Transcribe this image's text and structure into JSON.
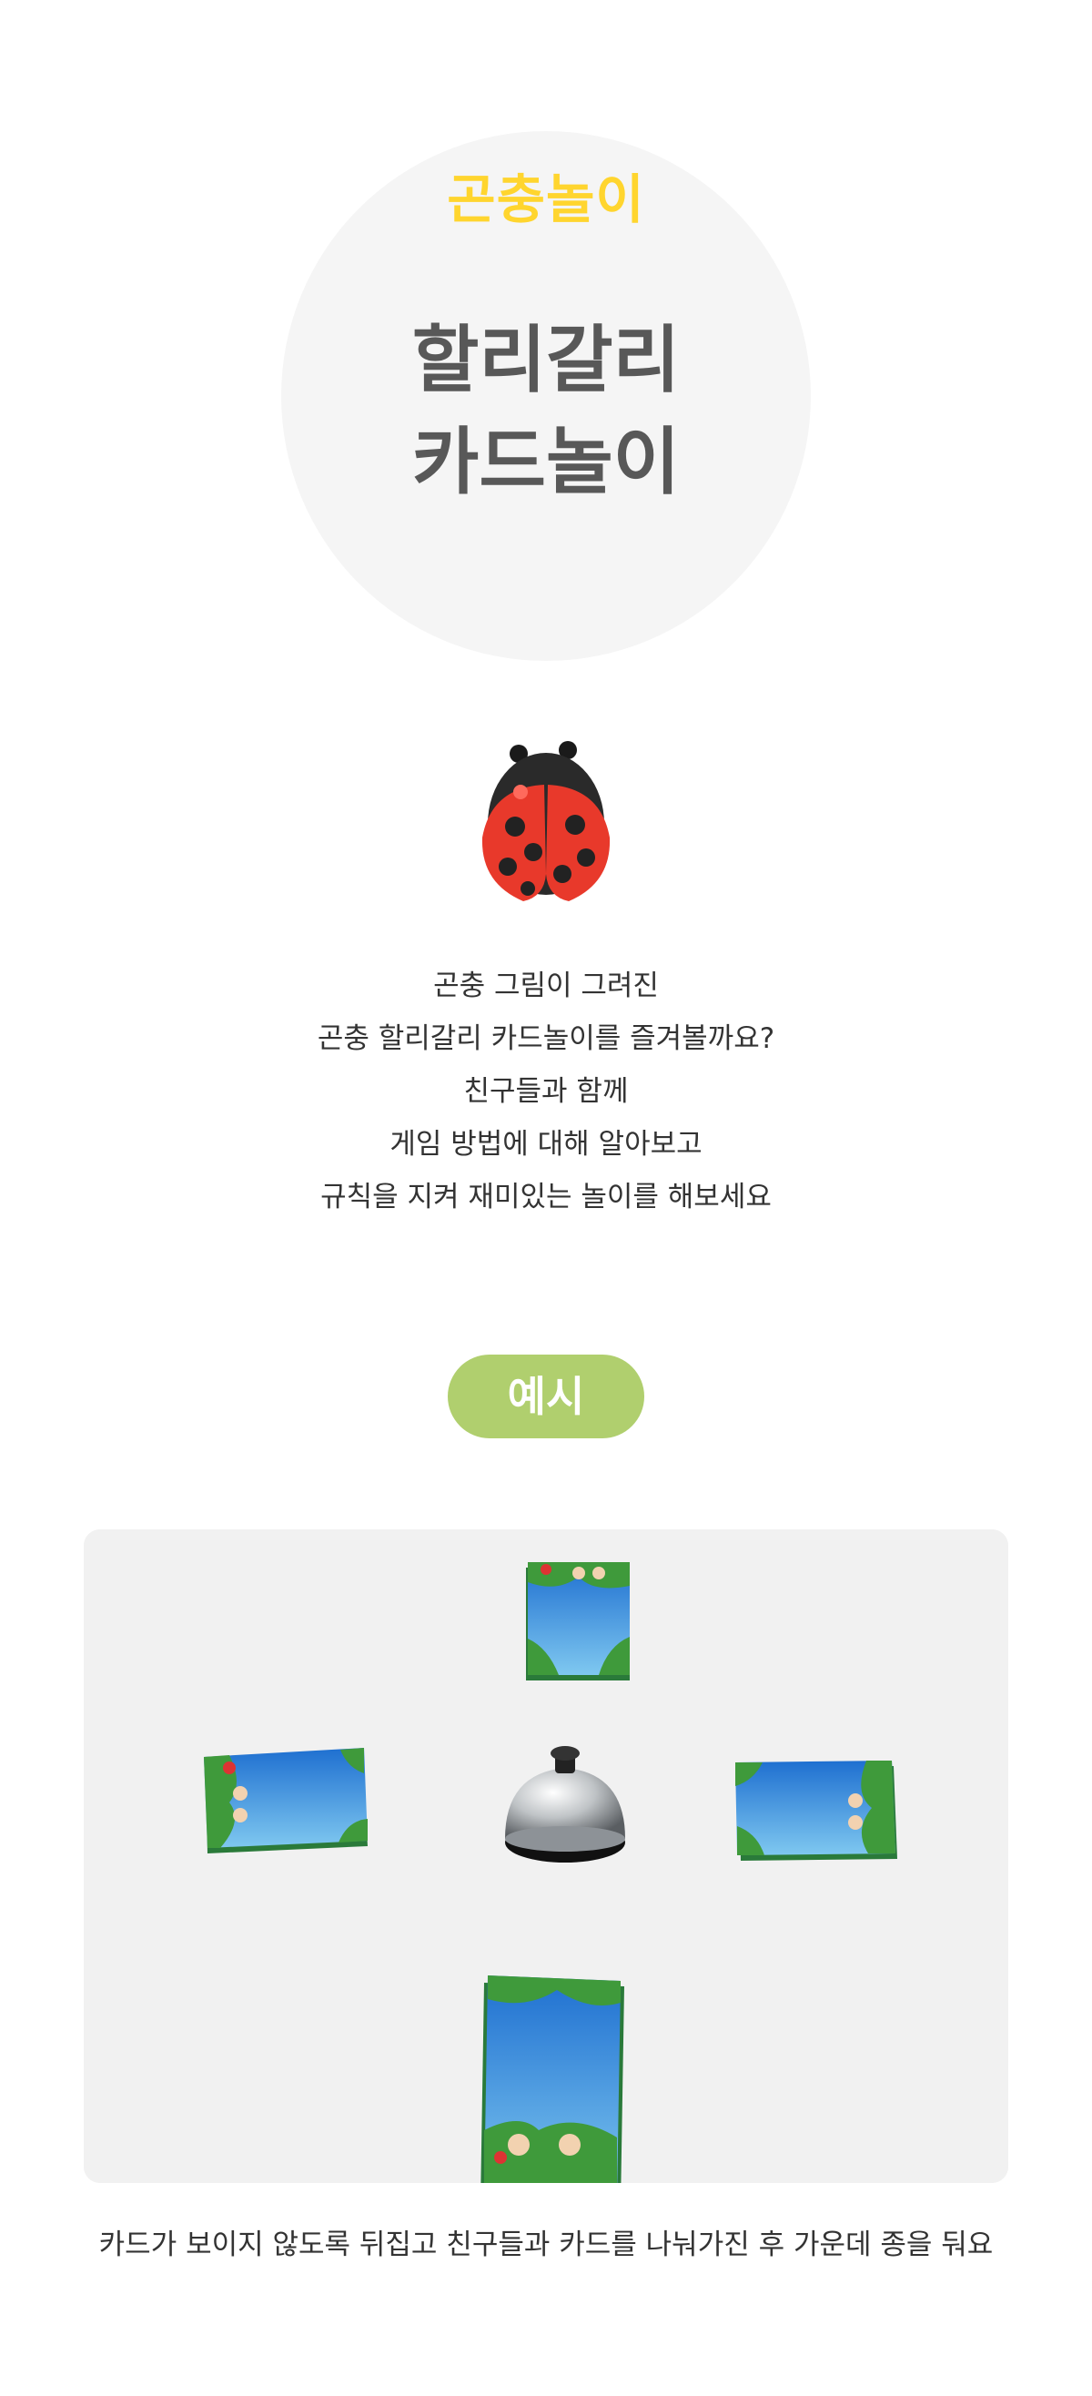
{
  "hero": {
    "category": "곤충놀이",
    "title_line1": "할리갈리",
    "title_line2": "카드놀이"
  },
  "intro": {
    "lines": [
      "곤충 그림이 그려진",
      "곤충 할리갈리 카드놀이를 즐겨볼까요?",
      "친구들과 함께",
      "게임 방법에 대해 알아보고",
      "규칙을 지켜 재미있는 놀이를 해보세요"
    ]
  },
  "example": {
    "label": "예시",
    "caption": "카드가 보이지 않도록 뒤집고 친구들과 카드를 나눠가진 후 가운데 종을 둬요"
  },
  "colors": {
    "category": "#ffd52e",
    "title": "#585858",
    "pill": "#b0cf6e",
    "circle": "#f5f5f5",
    "ladybug_red": "#e8392b"
  },
  "icons": {
    "ladybug": "ladybug-icon",
    "bell": "desk-bell-icon"
  }
}
